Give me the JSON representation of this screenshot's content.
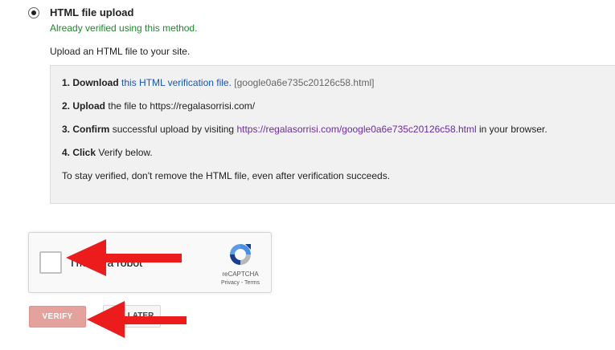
{
  "method": {
    "title": "HTML file upload",
    "verified_note": "Already verified using this method.",
    "intro": "Upload an HTML file to your site."
  },
  "steps": {
    "step1": {
      "bold": "1. Download",
      "link": "this HTML verification file.",
      "filename": "[google0a6e735c20126c58.html]"
    },
    "step2": {
      "bold": "2. Upload",
      "text": "the file to https://regalasorrisi.com/"
    },
    "step3": {
      "bold": "3. Confirm",
      "text_before": "successful upload by visiting",
      "link": "https://regalasorrisi.com/google0a6e735c20126c58.html",
      "text_after": "in your browser."
    },
    "step4": {
      "bold": "4. Click",
      "text": "Verify below."
    },
    "note": "To stay verified, don't remove the HTML file, even after verification succeeds."
  },
  "recaptcha": {
    "label": "I'm not a robot",
    "brand": "reCAPTCHA",
    "links": "Privacy - Terms"
  },
  "buttons": {
    "verify": "VERIFY",
    "second": "LATER"
  },
  "colors": {
    "verified_green": "#1c8a2c",
    "link_blue": "#1a55b8",
    "link_visited": "#6a2c9e",
    "verify_button": "#e5a19c",
    "annotation_arrow": "#ec1c1c"
  },
  "icons": {
    "radio": "radio-selected-icon",
    "recaptcha_logo": "recaptcha-logo-icon",
    "annotation_arrows": "red-arrow-icon"
  }
}
